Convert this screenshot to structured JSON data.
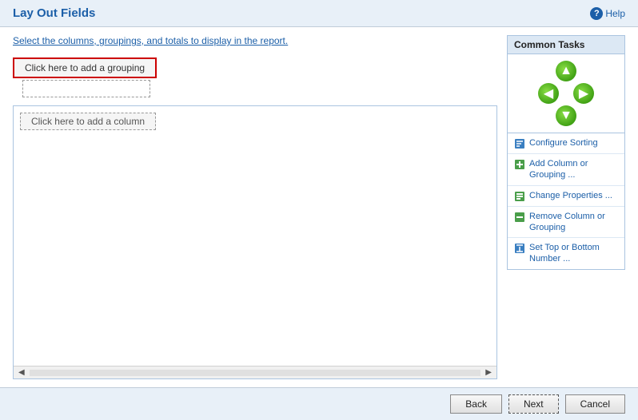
{
  "header": {
    "title": "Lay Out Fields",
    "help_label": "Help"
  },
  "instruction": {
    "text_before": "Select the columns, groupings, and totals to ",
    "text_link": "display",
    "text_after": " in the report."
  },
  "grouping": {
    "add_btn_label": "Click here to add a grouping"
  },
  "column": {
    "add_btn_label": "Click here to add a column"
  },
  "common_tasks": {
    "header": "Common Tasks",
    "items": [
      {
        "id": "configure-sorting",
        "label": "Configure Sorting",
        "icon": "sorting-icon"
      },
      {
        "id": "add-column-grouping",
        "label": "Add Column or Grouping ...",
        "icon": "add-icon"
      },
      {
        "id": "change-properties",
        "label": "Change Properties ...",
        "icon": "change-icon"
      },
      {
        "id": "remove-column-grouping",
        "label": "Remove Column or Grouping",
        "icon": "change-icon"
      },
      {
        "id": "set-top-bottom",
        "label": "Set Top or Bottom Number ...",
        "icon": "set-icon"
      }
    ]
  },
  "footer": {
    "back_label": "Back",
    "next_label": "Next",
    "cancel_label": "Cancel"
  }
}
